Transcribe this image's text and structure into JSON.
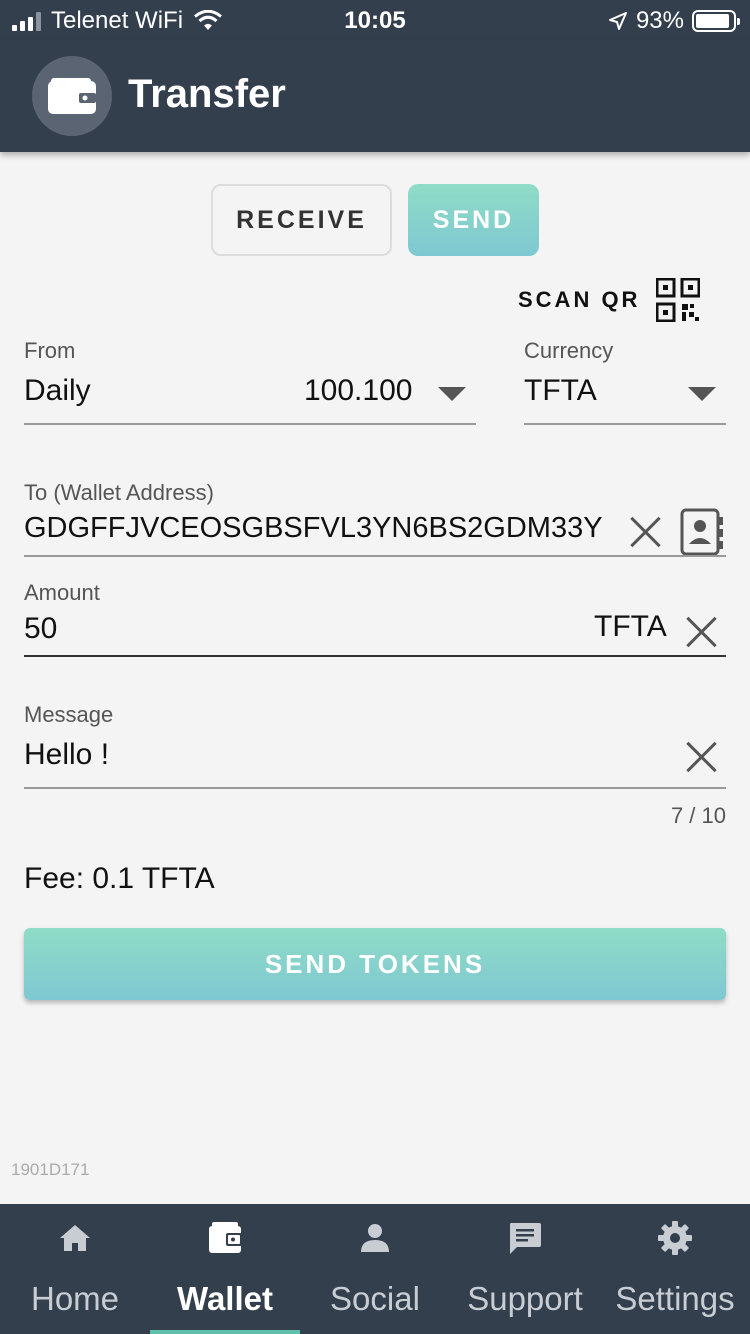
{
  "status_bar": {
    "carrier": "Telenet WiFi",
    "time": "10:05",
    "battery": "93%",
    "battery_level": 0.93
  },
  "header": {
    "title": "Transfer",
    "icon": "wallet-icon"
  },
  "mode_toggle": {
    "receive_label": "RECEIVE",
    "send_label": "SEND",
    "selected": "SEND"
  },
  "scan_qr": {
    "label": "SCAN QR",
    "icon": "qr-code-icon"
  },
  "form": {
    "from": {
      "label": "From",
      "value": "Daily",
      "balance": "100.100"
    },
    "currency": {
      "label": "Currency",
      "value": "TFTA"
    },
    "to": {
      "label": "To (Wallet Address)",
      "value": "GDGFFJVCEOSGBSFVL3YN6BS2GDM33Y"
    },
    "amount": {
      "label": "Amount",
      "value": "50",
      "unit": "TFTA"
    },
    "message": {
      "label": "Message",
      "value": "Hello !",
      "counter": "7 / 10"
    }
  },
  "fee": "Fee: 0.1 TFTA",
  "send_tokens_label": "SEND TOKENS",
  "build_id": "1901D171",
  "colors": {
    "header_bg": "#343f4e",
    "accent_gradient_top": "#8fdcc6",
    "accent_gradient_bottom": "#7ec8d2",
    "nav_active_indicator": "#5fbfa8"
  },
  "bottom_nav": {
    "items": [
      {
        "label": "Home",
        "icon": "home-icon"
      },
      {
        "label": "Wallet",
        "icon": "wallet-icon"
      },
      {
        "label": "Social",
        "icon": "person-icon"
      },
      {
        "label": "Support",
        "icon": "chat-icon"
      },
      {
        "label": "Settings",
        "icon": "gear-icon"
      }
    ],
    "active": "Wallet"
  }
}
